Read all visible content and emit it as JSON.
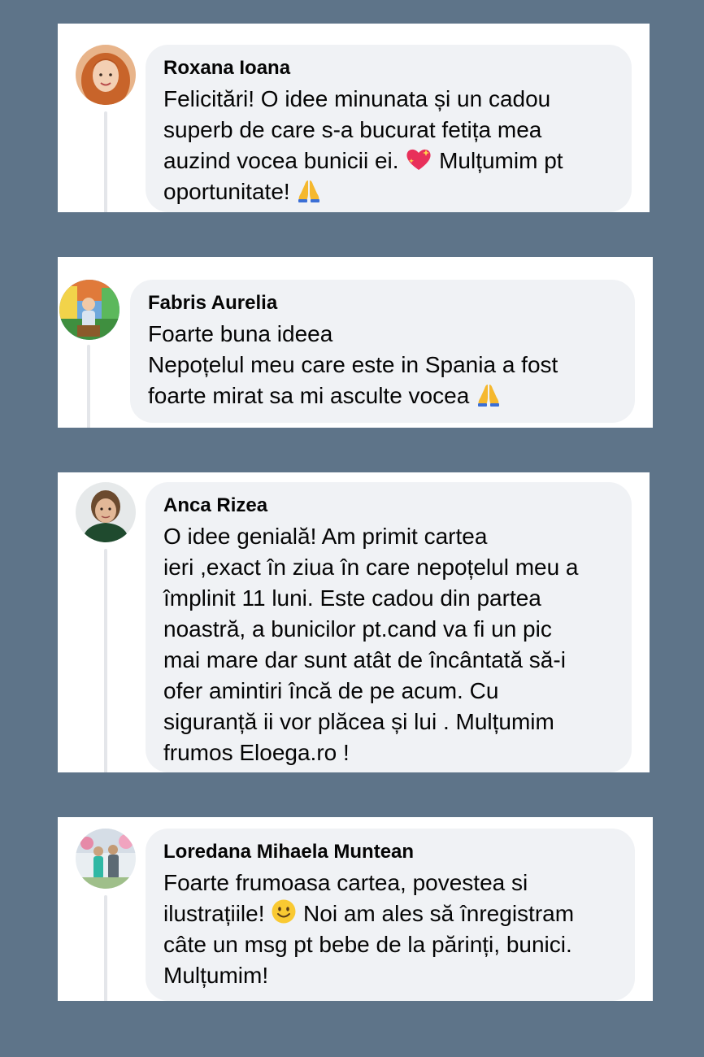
{
  "comments": [
    {
      "author": "Roxana Ioana",
      "lines": [
        "Felicitări! O idee minunata și un cadou",
        "superb de care s-a bucurat fetița mea",
        "auzind vocea bunicii ei. ",
        "Mulțumim pt",
        "oportunitate! "
      ],
      "emojis": [
        "sparkling-heart",
        "folded-hands"
      ]
    },
    {
      "author": "Fabris Aurelia",
      "lines": [
        "Foarte buna ideea",
        "Nepoțelul meu care este in Spania a fost",
        "foarte mirat sa mi asculte vocea "
      ],
      "emojis": [
        "folded-hands"
      ]
    },
    {
      "author": "Anca Rizea",
      "lines": [
        "O idee genială! Am primit cartea",
        "ieri ,exact în ziua în care nepoțelul meu a",
        "împlinit 11 luni. Este cadou din partea",
        "noastră, a bunicilor pt.cand va fi un pic",
        "mai mare dar sunt atât de încântată să-i",
        "ofer amintiri încă de pe acum. Cu",
        "siguranță ii vor plăcea și lui . Mulțumim",
        "frumos Eloega.ro !"
      ],
      "emojis": []
    },
    {
      "author": "Loredana Mihaela Muntean",
      "lines": [
        "Foarte frumoasa cartea, povestea si",
        "ilustrațiile! ",
        " Noi am ales să înregistram",
        "câte un msg pt bebe de la părinți, bunici.",
        "Mulțumim!"
      ],
      "emojis": [
        "smiling-face"
      ]
    }
  ],
  "colors": {
    "background": "#5e7489",
    "card": "#ffffff",
    "bubble": "#f0f2f5",
    "text": "#050505",
    "thread_line": "#e4e6ea"
  }
}
